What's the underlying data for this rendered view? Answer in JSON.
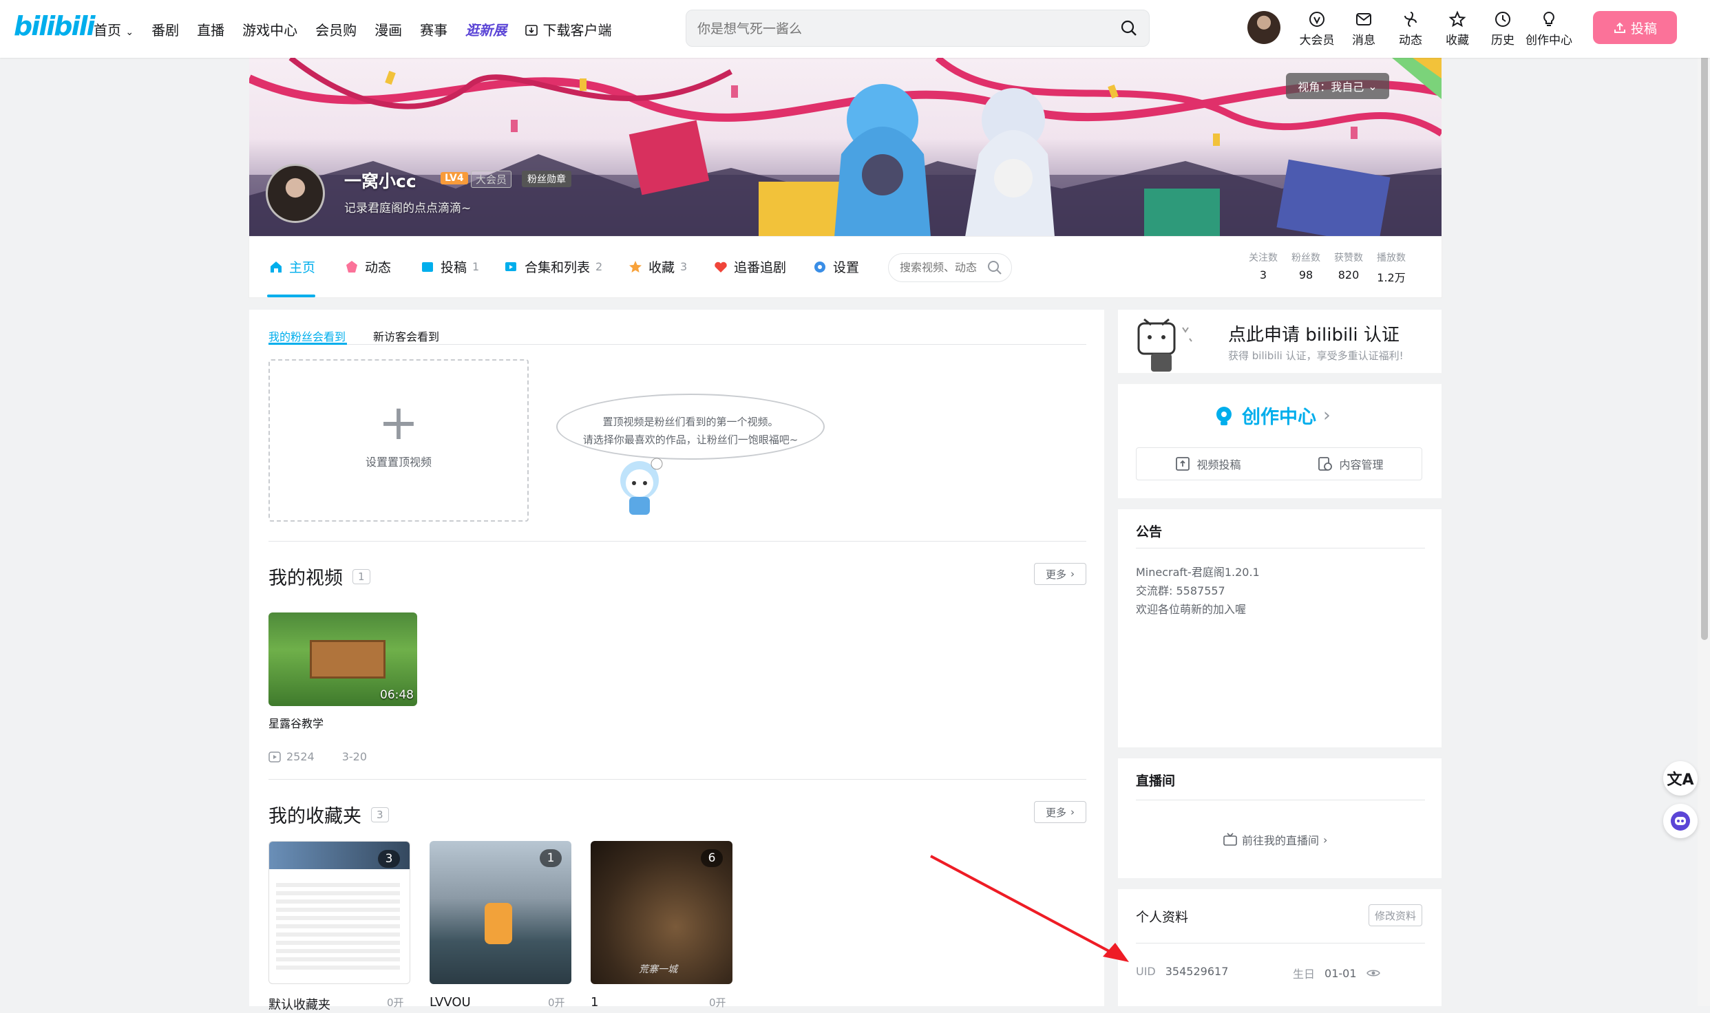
{
  "topnav": {
    "logo": "bilibili",
    "links": [
      "首页",
      "番剧",
      "直播",
      "游戏中心",
      "会员购",
      "漫画",
      "赛事",
      "逛新展",
      "下载客户端"
    ],
    "search_placeholder": "你是想气死一酱么",
    "icons": [
      {
        "label": "大会员",
        "icon": "vip-icon"
      },
      {
        "label": "消息",
        "icon": "mail-icon"
      },
      {
        "label": "动态",
        "icon": "wind-icon"
      },
      {
        "label": "收藏",
        "icon": "star-icon"
      },
      {
        "label": "历史",
        "icon": "clock-icon"
      },
      {
        "label": "创作中心",
        "icon": "bulb-icon"
      }
    ],
    "upload": "投稿"
  },
  "banner": {
    "view_switch": "视角：我自己",
    "username": "一窝小cc",
    "level": "LV4",
    "vip": "大会员",
    "medal": "粉丝勋章",
    "sign": "记录君庭阁的点点滴滴~"
  },
  "tabs": [
    {
      "label": "主页",
      "count": ""
    },
    {
      "label": "动态",
      "count": ""
    },
    {
      "label": "投稿",
      "count": "1"
    },
    {
      "label": "合集和列表",
      "count": "2"
    },
    {
      "label": "收藏",
      "count": "3"
    },
    {
      "label": "追番追剧",
      "count": ""
    },
    {
      "label": "设置",
      "count": ""
    }
  ],
  "tab_search_placeholder": "搜索视频、动态",
  "stats": [
    {
      "label": "关注数",
      "value": "3"
    },
    {
      "label": "粉丝数",
      "value": "98"
    },
    {
      "label": "获赞数",
      "value": "820"
    },
    {
      "label": "播放数",
      "value": "1.2万"
    }
  ],
  "main": {
    "subtabs": [
      "我的粉丝会看到",
      "新访客会看到"
    ],
    "pin_label": "设置置顶视频",
    "bubble_line1": "置顶视频是粉丝们看到的第一个视频。",
    "bubble_line2": "请选择你最喜欢的作品，让粉丝们一饱眼福吧~",
    "videos_title": "我的视频",
    "videos_count": "1",
    "more": "更多",
    "video": {
      "duration": "06:48",
      "title": "星露谷教学",
      "plays": "2524",
      "date": "3-20"
    },
    "favs_title": "我的收藏夹",
    "favs_count": "3",
    "favs": [
      {
        "count": "3",
        "label": "默认收藏夹",
        "sub": "0开"
      },
      {
        "count": "1",
        "label": "LVVOU",
        "sub": "0开"
      },
      {
        "count": "6",
        "label": "1",
        "sub": "0开"
      }
    ],
    "fav3_caption": "荒寨一城"
  },
  "right": {
    "cert_title": "点此申请 bilibili 认证",
    "cert_sub": "获得 bilibili 认证，享受多重认证福利!",
    "creator_title": "创作中心",
    "creator_btn1": "视频投稿",
    "creator_btn2": "内容管理",
    "notice_title": "公告",
    "notice_lines": [
      "Minecraft-君庭阁1.20.1",
      "交流群: 5587557",
      "欢迎各位萌新的加入喔"
    ],
    "live_title": "直播间",
    "live_link": "前往我的直播间",
    "profile_title": "个人资料",
    "edit_profile": "修改资料",
    "uid_label": "UID",
    "uid_value": "354529617",
    "bday_label": "生日",
    "bday_value": "01-01"
  },
  "colors": {
    "accent": "#00aeec",
    "pink": "#fb7299",
    "annotation_arrow": "#ee1c25"
  }
}
